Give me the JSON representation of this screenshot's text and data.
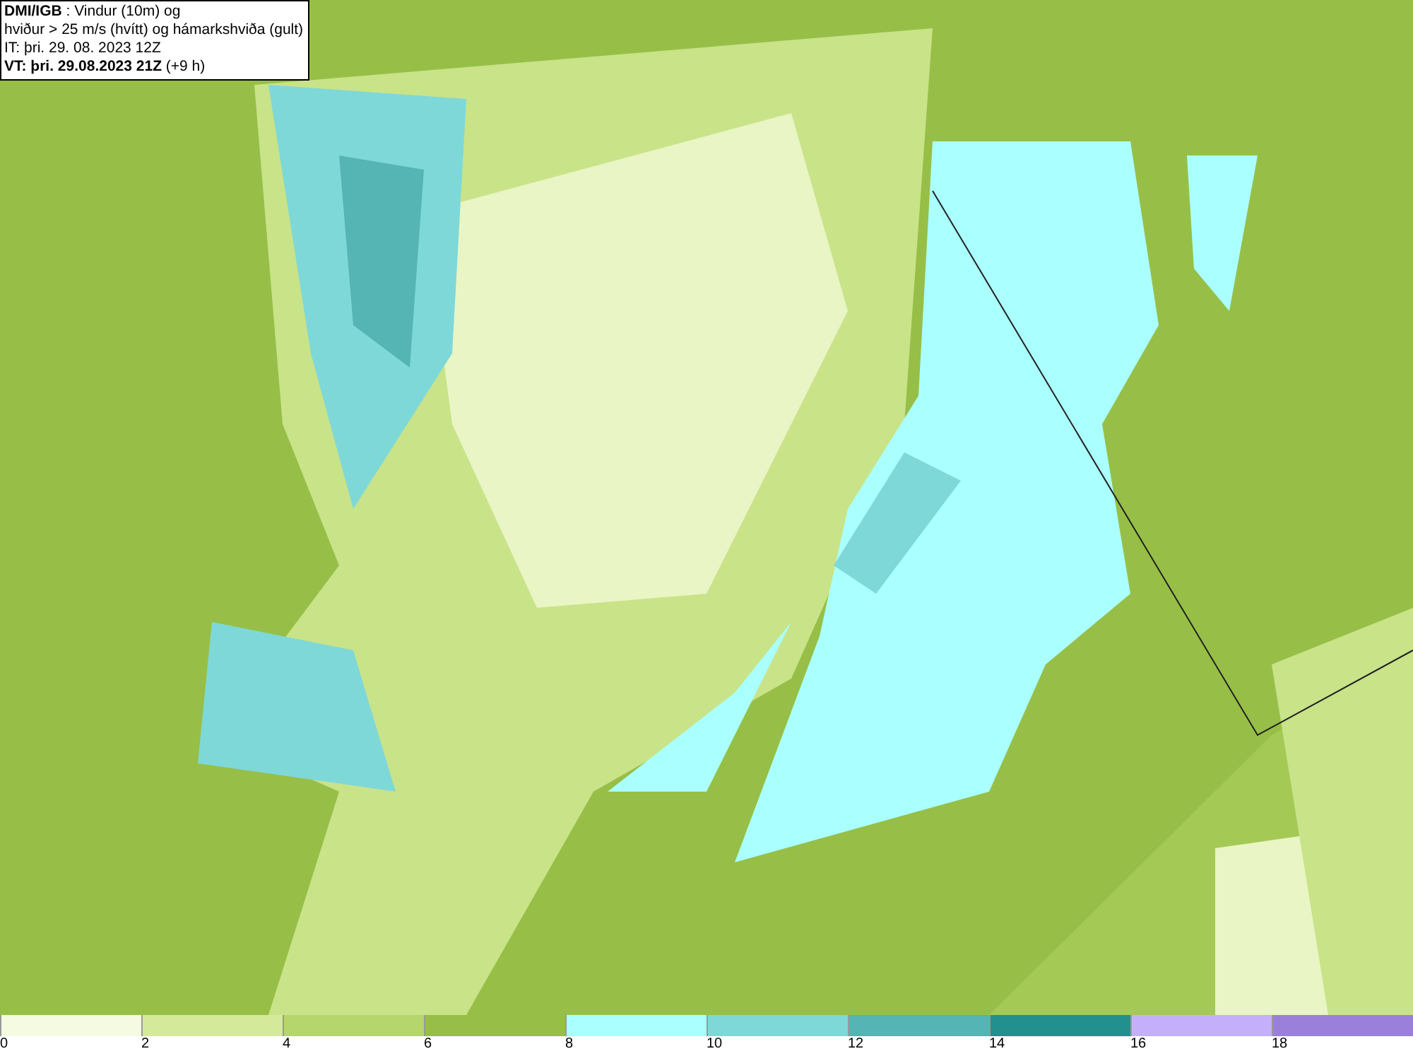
{
  "header": {
    "lines": [
      "**DMI/IGB** : Vindur (10m) og",
      "hviður > 25 m/s (hvítt) og hámarkshviða (gult)",
      "IT: þri. 29. 08. 2023 12Z",
      "**VT: þri. 29.08.2023 21Z** (+9 h)"
    ]
  },
  "legend": [
    {
      "label": "0",
      "color": "#f4fbe0"
    },
    {
      "label": "2",
      "color": "#d4ea9a"
    },
    {
      "label": "4",
      "color": "#b5d66c"
    },
    {
      "label": "6",
      "color": "#97bf47"
    },
    {
      "label": "8",
      "color": "#aaffff"
    },
    {
      "label": "10",
      "color": "#7fd8d8"
    },
    {
      "label": "12",
      "color": "#55b4b4"
    },
    {
      "label": "14",
      "color": "#239090"
    },
    {
      "label": "16",
      "color": "#c4b0fa"
    },
    {
      "label": "18",
      "color": "#9a80da"
    }
  ]
}
